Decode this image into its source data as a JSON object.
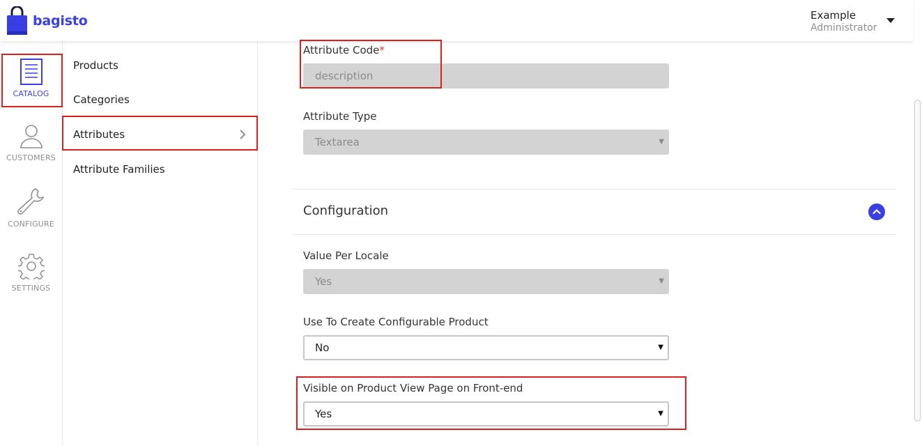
{
  "brand": {
    "name": "bagisto",
    "accent": "#3a3fe4"
  },
  "user": {
    "name": "Example",
    "role": "Administrator"
  },
  "icon_nav": [
    {
      "label": "CATALOG",
      "icon": "catalog-icon",
      "active": true
    },
    {
      "label": "CUSTOMERS",
      "icon": "user-icon",
      "active": false
    },
    {
      "label": "CONFIGURE",
      "icon": "wrench-icon",
      "active": false
    },
    {
      "label": "SETTINGS",
      "icon": "gear-icon",
      "active": false
    }
  ],
  "submenu": [
    {
      "label": "Products"
    },
    {
      "label": "Categories"
    },
    {
      "label": "Attributes",
      "active": true
    },
    {
      "label": "Attribute Families"
    }
  ],
  "form": {
    "attribute_code": {
      "label": "Attribute Code",
      "required_mark": "*",
      "value": "description"
    },
    "attribute_type": {
      "label": "Attribute Type",
      "value": "Textarea"
    },
    "configuration": {
      "title": "Configuration",
      "value_per_locale": {
        "label": "Value Per Locale",
        "value": "Yes"
      },
      "configurable": {
        "label": "Use To Create Configurable Product",
        "value": "No"
      },
      "visible_front": {
        "label": "Visible on Product View Page on Front-end",
        "value": "Yes"
      }
    }
  },
  "colors": {
    "highlight": "#d91e1e",
    "required": "#f0303a",
    "disabled_bg": "#d3d3d3"
  }
}
